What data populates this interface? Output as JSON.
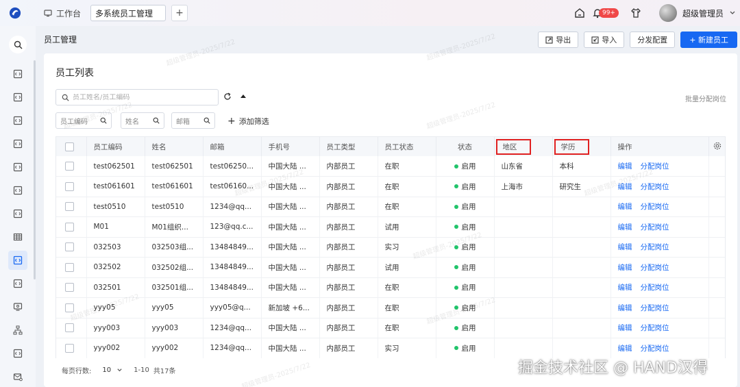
{
  "topbar": {
    "home_tab": "工作台",
    "active_tab": "多系统员工管理",
    "add_tab": "+",
    "badge": "99+",
    "username": "超级管理员"
  },
  "page": {
    "title": "员工管理",
    "buttons": {
      "export": "导出",
      "import": "导入",
      "distribute": "分发配置",
      "create": "+ 新建员工"
    }
  },
  "card": {
    "title": "员工列表",
    "search_placeholder": "员工姓名/员工编码",
    "bulk": "批量分配岗位",
    "filters": [
      "员工编码",
      "姓名",
      "邮箱"
    ],
    "add_filter": "添加筛选"
  },
  "table": {
    "headers": [
      "员工编码",
      "姓名",
      "邮箱",
      "手机号",
      "员工类型",
      "员工状态",
      "状态",
      "地区",
      "学历",
      "操作"
    ],
    "edit": "编辑",
    "assign": "分配岗位",
    "rows": [
      {
        "code": "test062501",
        "name": "test062501",
        "email": "test06250...",
        "phone": "中国大陆 ...",
        "type": "内部员工",
        "emp_status": "在职",
        "status": "启用",
        "region": "山东省",
        "edu": "本科"
      },
      {
        "code": "test061601",
        "name": "test061601",
        "email": "test06160...",
        "phone": "中国大陆 ...",
        "type": "内部员工",
        "emp_status": "在职",
        "status": "启用",
        "region": "上海市",
        "edu": "研究生"
      },
      {
        "code": "test0510",
        "name": "test0510",
        "email": "1234@qq...",
        "phone": "中国大陆 ...",
        "type": "内部员工",
        "emp_status": "在职",
        "status": "启用",
        "region": "",
        "edu": ""
      },
      {
        "code": "M01",
        "name": "M01组织...",
        "email": "123@qq.c...",
        "phone": "中国大陆 ...",
        "type": "内部员工",
        "emp_status": "试用",
        "status": "启用",
        "region": "",
        "edu": ""
      },
      {
        "code": "032503",
        "name": "032503组...",
        "email": "13484849...",
        "phone": "中国大陆 ...",
        "type": "内部员工",
        "emp_status": "实习",
        "status": "启用",
        "region": "",
        "edu": ""
      },
      {
        "code": "032502",
        "name": "032502组...",
        "email": "13484849...",
        "phone": "中国大陆 ...",
        "type": "内部员工",
        "emp_status": "试用",
        "status": "启用",
        "region": "",
        "edu": ""
      },
      {
        "code": "032501",
        "name": "032501组...",
        "email": "13484849...",
        "phone": "中国大陆 ...",
        "type": "内部员工",
        "emp_status": "在职",
        "status": "启用",
        "region": "",
        "edu": ""
      },
      {
        "code": "yyy05",
        "name": "yyy05",
        "email": "yyy05@q...",
        "phone": "新加坡 +6...",
        "type": "内部员工",
        "emp_status": "在职",
        "status": "启用",
        "region": "",
        "edu": ""
      },
      {
        "code": "yyy003",
        "name": "yyy003",
        "email": "1234@qq...",
        "phone": "中国大陆 ...",
        "type": "内部员工",
        "emp_status": "在职",
        "status": "启用",
        "region": "",
        "edu": ""
      },
      {
        "code": "yyy002",
        "name": "yyy002",
        "email": "1234@qq...",
        "phone": "中国大陆 ...",
        "type": "内部员工",
        "emp_status": "实习",
        "status": "启用",
        "region": "",
        "edu": ""
      }
    ]
  },
  "pager": {
    "rows_label": "每页行数:",
    "page_size": "10",
    "range": "1-10",
    "total": "共17条"
  },
  "watermark": "超级管理员-2025/7/22",
  "brand_watermark": "掘金技术社区 @ HAND汉得",
  "colors": {
    "primary": "#1768f2",
    "enabled_dot": "#21c46b",
    "highlight": "#e02020",
    "badge": "#f04848"
  }
}
